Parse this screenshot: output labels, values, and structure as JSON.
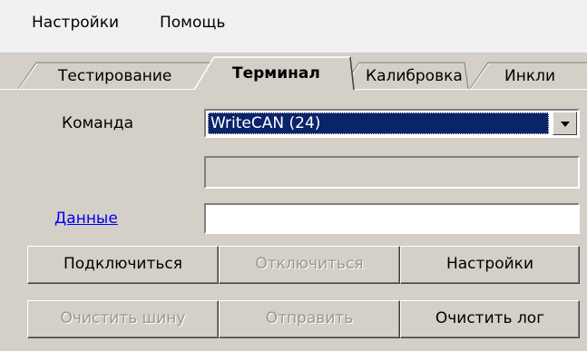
{
  "menubar": {
    "items": [
      "Настройки",
      "Помощь"
    ]
  },
  "tabs": [
    {
      "label": "Тестирование",
      "active": false
    },
    {
      "label": "Терминал",
      "active": true
    },
    {
      "label": "Калибровка",
      "active": false
    },
    {
      "label": "Инкли",
      "active": false
    }
  ],
  "form": {
    "command_label": "Команда",
    "command_value": "WriteCAN (24)",
    "secondary_value": "",
    "data_label": "Данные",
    "data_value": ""
  },
  "buttons": {
    "connect": "Подключиться",
    "disconnect": "Отключиться",
    "settings": "Настройки",
    "clear_bus": "Очистить шину",
    "send": "Отправить",
    "clear_log": "Очистить лог"
  },
  "colors": {
    "selection": "#0a246a",
    "link": "#0000ee",
    "face": "#d4d0c8"
  },
  "icons": {
    "combo_arrow": "chevron-down-icon"
  }
}
